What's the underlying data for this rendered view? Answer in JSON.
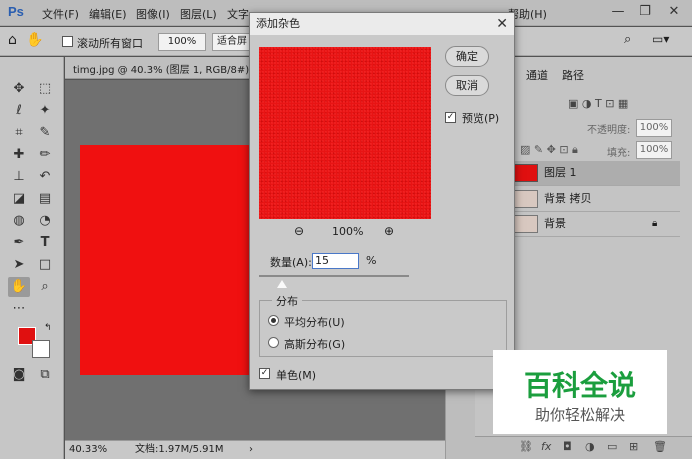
{
  "menubar": {
    "logo": "Ps",
    "items": [
      "文件(F)",
      "编辑(E)",
      "图像(I)",
      "图层(L)",
      "文字"
    ],
    "help": "帮助(H)"
  },
  "options": {
    "scroll_all": "滚动所有窗口",
    "zoom": "100%",
    "fit_screen": "适合屏"
  },
  "document": {
    "tab_title": "timg.jpg @ 40.3% (图层 1, RGB/8#) *",
    "status_zoom": "40.33%",
    "status_doc": "文档:1.97M/5.91M"
  },
  "layers_panel": {
    "tabs": [
      "通道",
      "路径"
    ],
    "opacity_label": "不透明度:",
    "opacity_value": "100%",
    "fill_label": "填充:",
    "fill_value": "100%",
    "layers": [
      {
        "name": "图层 1",
        "selected": true,
        "color": "#e01010"
      },
      {
        "name": "背景 拷贝",
        "selected": false
      },
      {
        "name": "背景",
        "selected": false,
        "locked": true
      }
    ]
  },
  "dialog": {
    "title": "添加杂色",
    "ok": "确定",
    "cancel": "取消",
    "preview_label": "预览(P)",
    "preview_checked": true,
    "zoom_level": "100%",
    "amount_label": "数量(A):",
    "amount_value": "15",
    "amount_unit": "%",
    "amount_slider_fraction": 0.15,
    "distribution_label": "分布",
    "uniform": "平均分布(U)",
    "gaussian": "高斯分布(G)",
    "selected_distribution": "uniform",
    "mono_label": "单色(M)",
    "mono_checked": true,
    "noise_color": "#e81414"
  },
  "watermark": {
    "title": "百科全说",
    "subtitle": "助你轻松解决"
  },
  "icons": {
    "zoom_out": "zoom-out-icon",
    "zoom_in": "zoom-in-icon"
  }
}
